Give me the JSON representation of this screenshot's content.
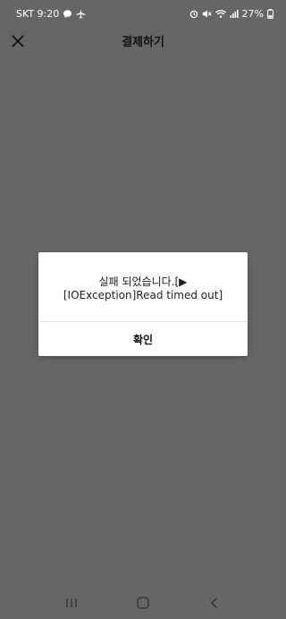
{
  "status_bar": {
    "carrier_time": "SKT 9:20",
    "battery": "27%",
    "icons": [
      "chat-bubble-icon",
      "airplane-icon",
      "alarm-icon",
      "mute-icon",
      "wifi-icon",
      "signal-icon",
      "battery-icon"
    ]
  },
  "header": {
    "title": "결제하기",
    "close_icon": "close-icon"
  },
  "dialog": {
    "message": "실패 되었습니다.[▶ [IOException]Read timed out]",
    "confirm_label": "확인"
  },
  "nav_bar": {
    "icons": [
      "recent-apps-icon",
      "home-icon",
      "back-icon"
    ]
  },
  "colors": {
    "overlay": "#666666",
    "dialog_bg": "#ffffff",
    "text": "#111111"
  }
}
